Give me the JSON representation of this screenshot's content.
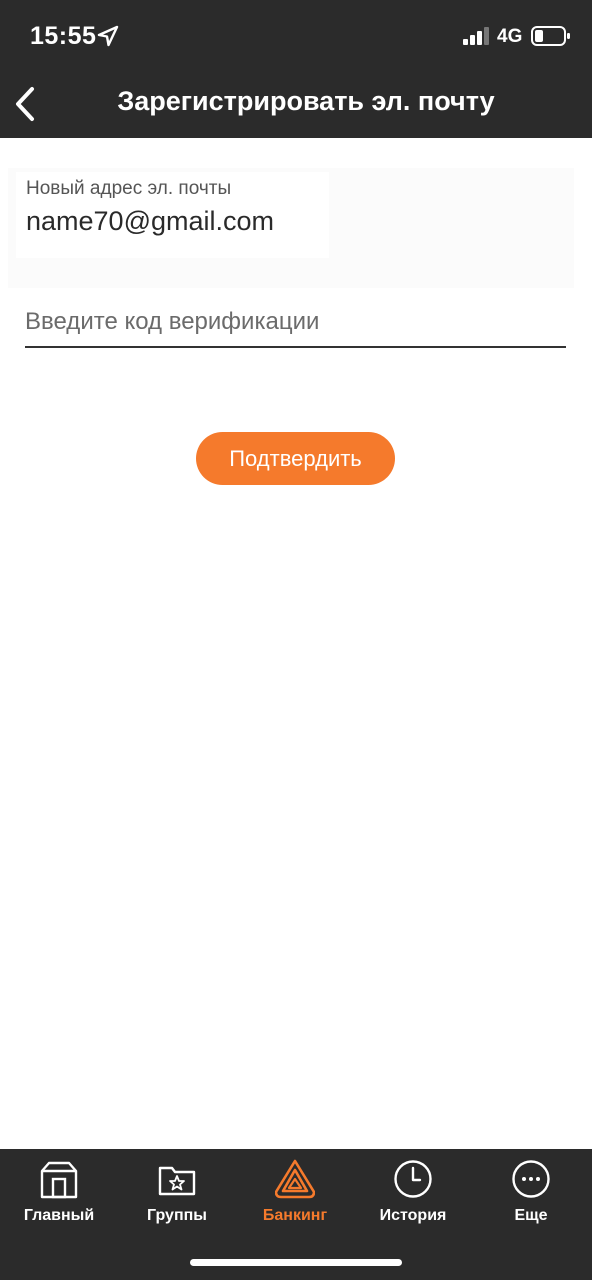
{
  "status_bar": {
    "time": "15:55",
    "network": "4G"
  },
  "nav": {
    "title": "Зарегистрировать эл. почту"
  },
  "email": {
    "label": "Новый адрес эл. почты",
    "value": "name70@gmail.com"
  },
  "verification": {
    "placeholder": "Введите код верификации"
  },
  "confirm_button": {
    "label": "Подтвердить"
  },
  "tabs": [
    {
      "label": "Главный",
      "icon": "home-icon"
    },
    {
      "label": "Группы",
      "icon": "groups-folder-icon"
    },
    {
      "label": "Банкинг",
      "icon": "banking-icon",
      "active": true
    },
    {
      "label": "История",
      "icon": "clock-icon"
    },
    {
      "label": "Еще",
      "icon": "more-icon"
    }
  ],
  "colors": {
    "header_bg": "#2b2b2b",
    "accent": "#f57a2c"
  }
}
